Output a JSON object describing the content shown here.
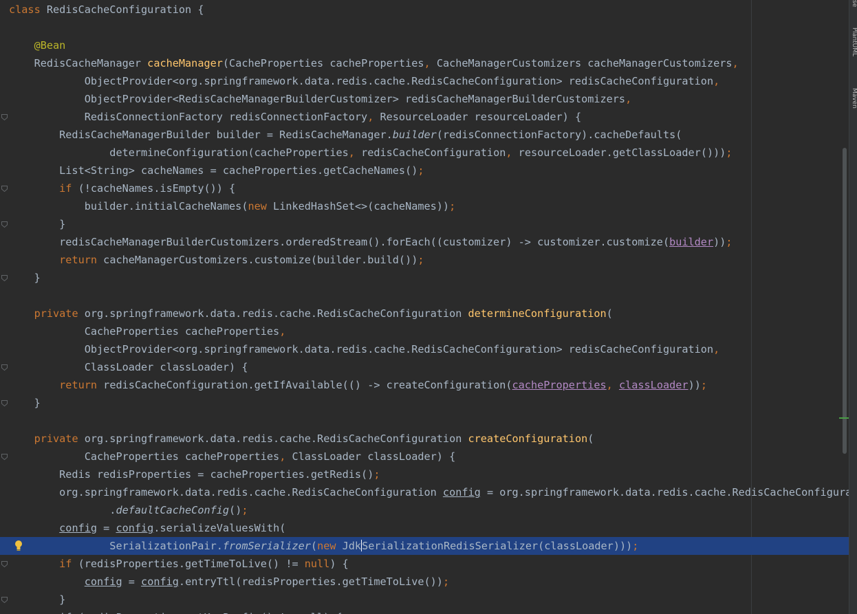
{
  "editor": {
    "lines": [
      [
        {
          "t": "class ",
          "c": "k"
        },
        {
          "t": "RedisCacheConfiguration {"
        }
      ],
      [],
      [
        {
          "t": "    "
        },
        {
          "t": "@Bean",
          "c": "an"
        }
      ],
      [
        {
          "t": "    RedisCacheManager "
        },
        {
          "t": "cacheManager",
          "c": "m"
        },
        {
          "t": "(CacheProperties cacheProperties"
        },
        {
          "t": ", ",
          "c": "k"
        },
        {
          "t": "CacheManagerCustomizers cacheManagerCustomizers"
        },
        {
          "t": ",",
          "c": "k"
        }
      ],
      [
        {
          "t": "            ObjectProvider<org.springframework.data.redis.cache.RedisCacheConfiguration> redisCacheConfiguration"
        },
        {
          "t": ",",
          "c": "k"
        }
      ],
      [
        {
          "t": "            ObjectProvider<RedisCacheManagerBuilderCustomizer> redisCacheManagerBuilderCustomizers"
        },
        {
          "t": ",",
          "c": "k"
        }
      ],
      [
        {
          "t": "            RedisConnectionFactory redisConnectionFactory"
        },
        {
          "t": ", ",
          "c": "k"
        },
        {
          "t": "ResourceLoader resourceLoader) {"
        }
      ],
      [
        {
          "t": "        RedisCacheManagerBuilder builder = RedisCacheManager."
        },
        {
          "t": "builder",
          "c": "it"
        },
        {
          "t": "(redisConnectionFactory).cacheDefaults("
        }
      ],
      [
        {
          "t": "                determineConfiguration(cacheProperties"
        },
        {
          "t": ", ",
          "c": "k"
        },
        {
          "t": "redisCacheConfiguration"
        },
        {
          "t": ", ",
          "c": "k"
        },
        {
          "t": "resourceLoader.getClassLoader()))"
        },
        {
          "t": ";",
          "c": "k"
        }
      ],
      [
        {
          "t": "        List<String> cacheNames = cacheProperties.getCacheNames()"
        },
        {
          "t": ";",
          "c": "k"
        }
      ],
      [
        {
          "t": "        "
        },
        {
          "t": "if ",
          "c": "k"
        },
        {
          "t": "(!cacheNames.isEmpty()) {"
        }
      ],
      [
        {
          "t": "            builder.initialCacheNames("
        },
        {
          "t": "new ",
          "c": "k"
        },
        {
          "t": "LinkedHashSet<>(cacheNames))"
        },
        {
          "t": ";",
          "c": "k"
        }
      ],
      [
        {
          "t": "        }"
        }
      ],
      [
        {
          "t": "        redisCacheManagerBuilderCustomizers.orderedStream().forEach((customizer) -> customizer.customize("
        },
        {
          "t": "builder",
          "c": "fu"
        },
        {
          "t": "))"
        },
        {
          "t": ";",
          "c": "k"
        }
      ],
      [
        {
          "t": "        "
        },
        {
          "t": "return ",
          "c": "k"
        },
        {
          "t": "cacheManagerCustomizers.customize(builder.build())"
        },
        {
          "t": ";",
          "c": "k"
        }
      ],
      [
        {
          "t": "    }"
        }
      ],
      [],
      [
        {
          "t": "    "
        },
        {
          "t": "private ",
          "c": "k"
        },
        {
          "t": "org.springframework.data.redis.cache.RedisCacheConfiguration "
        },
        {
          "t": "determineConfiguration",
          "c": "m"
        },
        {
          "t": "("
        }
      ],
      [
        {
          "t": "            CacheProperties cacheProperties"
        },
        {
          "t": ",",
          "c": "k"
        }
      ],
      [
        {
          "t": "            ObjectProvider<org.springframework.data.redis.cache.RedisCacheConfiguration> redisCacheConfiguration"
        },
        {
          "t": ",",
          "c": "k"
        }
      ],
      [
        {
          "t": "            ClassLoader classLoader) {"
        }
      ],
      [
        {
          "t": "        "
        },
        {
          "t": "return ",
          "c": "k"
        },
        {
          "t": "redisCacheConfiguration.getIfAvailable(() -> createConfiguration("
        },
        {
          "t": "cacheProperties",
          "c": "fu"
        },
        {
          "t": ", ",
          "c": "k"
        },
        {
          "t": "classLoader",
          "c": "fu"
        },
        {
          "t": "))"
        },
        {
          "t": ";",
          "c": "k"
        }
      ],
      [
        {
          "t": "    }"
        }
      ],
      [],
      [
        {
          "t": "    "
        },
        {
          "t": "private ",
          "c": "k"
        },
        {
          "t": "org.springframework.data.redis.cache.RedisCacheConfiguration "
        },
        {
          "t": "createConfiguration",
          "c": "m"
        },
        {
          "t": "("
        }
      ],
      [
        {
          "t": "            CacheProperties cacheProperties"
        },
        {
          "t": ", ",
          "c": "k"
        },
        {
          "t": "ClassLoader classLoader) {"
        }
      ],
      [
        {
          "t": "        Redis redisProperties = cacheProperties.getRedis()"
        },
        {
          "t": ";",
          "c": "k"
        }
      ],
      [
        {
          "t": "        org.springframework.data.redis.cache.RedisCacheConfiguration "
        },
        {
          "t": "config",
          "c": "ul"
        },
        {
          "t": " = org.springframework.data.redis.cache.RedisCacheConfigurati"
        }
      ],
      [
        {
          "t": "                ."
        },
        {
          "t": "defaultCacheConfig",
          "c": "it"
        },
        {
          "t": "()"
        },
        {
          "t": ";",
          "c": "k"
        }
      ],
      [
        {
          "t": "        "
        },
        {
          "t": "config",
          "c": "ul"
        },
        {
          "t": " = "
        },
        {
          "t": "config",
          "c": "ul"
        },
        {
          "t": ".serializeValuesWith("
        }
      ],
      [
        {
          "t": "                SerializationPair."
        },
        {
          "t": "fromSerializer",
          "c": "it"
        },
        {
          "t": "("
        },
        {
          "t": "new ",
          "c": "k"
        },
        {
          "t": "Jdk"
        },
        {
          "t": "",
          "c": "caret"
        },
        {
          "t": "SerializationRedisSerializer(classLoader)))"
        },
        {
          "t": ";",
          "c": "k"
        }
      ],
      [
        {
          "t": "        "
        },
        {
          "t": "if ",
          "c": "k"
        },
        {
          "t": "(redisProperties.getTimeToLive() != "
        },
        {
          "t": "null",
          "c": "k"
        },
        {
          "t": ") {"
        }
      ],
      [
        {
          "t": "            "
        },
        {
          "t": "config",
          "c": "ul"
        },
        {
          "t": " = "
        },
        {
          "t": "config",
          "c": "ul"
        },
        {
          "t": ".entryTtl(redisProperties.getTimeToLive())"
        },
        {
          "t": ";",
          "c": "k"
        }
      ],
      [
        {
          "t": "        }"
        }
      ],
      [
        {
          "t": "        if (redisProperties.getKeyPrefix() != null) {"
        }
      ]
    ],
    "current_line_index": 30,
    "folded_line_indices": [
      6,
      10,
      12,
      15,
      20,
      22,
      25,
      31,
      33
    ]
  },
  "side_panels": {
    "tab_top": "se",
    "tab_plantuml": "PlantUML",
    "tab_maven": "Maven"
  },
  "colors": {
    "background": "#2b2b2b",
    "text": "#a9b7c6",
    "keyword": "#cc7832",
    "method_decl": "#ffc66d",
    "annotation": "#bbb529",
    "field": "#b389c5",
    "current_line": "#214283"
  },
  "icons": {
    "bulb": "intention-bulb-icon",
    "fold": "fold-marker-icon"
  }
}
